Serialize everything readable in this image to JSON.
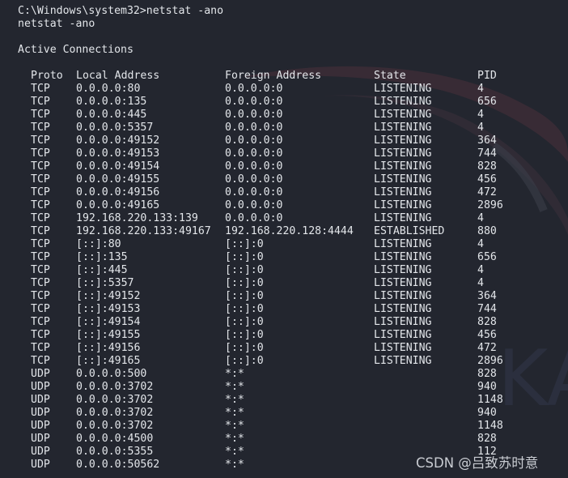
{
  "terminal": {
    "prompt_line": "C:\\Windows\\system32>netstat -ano",
    "echo_line": "netstat -ano",
    "section_title": "Active Connections",
    "headers": {
      "proto": "Proto",
      "local": "Local Address",
      "foreign": "Foreign Address",
      "state": "State",
      "pid": "PID"
    },
    "rows": [
      {
        "proto": "TCP",
        "local": "0.0.0.0:80",
        "foreign": "0.0.0.0:0",
        "state": "LISTENING",
        "pid": "4"
      },
      {
        "proto": "TCP",
        "local": "0.0.0.0:135",
        "foreign": "0.0.0.0:0",
        "state": "LISTENING",
        "pid": "656"
      },
      {
        "proto": "TCP",
        "local": "0.0.0.0:445",
        "foreign": "0.0.0.0:0",
        "state": "LISTENING",
        "pid": "4"
      },
      {
        "proto": "TCP",
        "local": "0.0.0.0:5357",
        "foreign": "0.0.0.0:0",
        "state": "LISTENING",
        "pid": "4"
      },
      {
        "proto": "TCP",
        "local": "0.0.0.0:49152",
        "foreign": "0.0.0.0:0",
        "state": "LISTENING",
        "pid": "364"
      },
      {
        "proto": "TCP",
        "local": "0.0.0.0:49153",
        "foreign": "0.0.0.0:0",
        "state": "LISTENING",
        "pid": "744"
      },
      {
        "proto": "TCP",
        "local": "0.0.0.0:49154",
        "foreign": "0.0.0.0:0",
        "state": "LISTENING",
        "pid": "828"
      },
      {
        "proto": "TCP",
        "local": "0.0.0.0:49155",
        "foreign": "0.0.0.0:0",
        "state": "LISTENING",
        "pid": "456"
      },
      {
        "proto": "TCP",
        "local": "0.0.0.0:49156",
        "foreign": "0.0.0.0:0",
        "state": "LISTENING",
        "pid": "472"
      },
      {
        "proto": "TCP",
        "local": "0.0.0.0:49165",
        "foreign": "0.0.0.0:0",
        "state": "LISTENING",
        "pid": "2896"
      },
      {
        "proto": "TCP",
        "local": "192.168.220.133:139",
        "foreign": "0.0.0.0:0",
        "state": "LISTENING",
        "pid": "4"
      },
      {
        "proto": "TCP",
        "local": "192.168.220.133:49167",
        "foreign": "192.168.220.128:4444",
        "state": "ESTABLISHED",
        "pid": "880"
      },
      {
        "proto": "TCP",
        "local": "[::]:80",
        "foreign": "[::]:0",
        "state": "LISTENING",
        "pid": "4"
      },
      {
        "proto": "TCP",
        "local": "[::]:135",
        "foreign": "[::]:0",
        "state": "LISTENING",
        "pid": "656"
      },
      {
        "proto": "TCP",
        "local": "[::]:445",
        "foreign": "[::]:0",
        "state": "LISTENING",
        "pid": "4"
      },
      {
        "proto": "TCP",
        "local": "[::]:5357",
        "foreign": "[::]:0",
        "state": "LISTENING",
        "pid": "4"
      },
      {
        "proto": "TCP",
        "local": "[::]:49152",
        "foreign": "[::]:0",
        "state": "LISTENING",
        "pid": "364"
      },
      {
        "proto": "TCP",
        "local": "[::]:49153",
        "foreign": "[::]:0",
        "state": "LISTENING",
        "pid": "744"
      },
      {
        "proto": "TCP",
        "local": "[::]:49154",
        "foreign": "[::]:0",
        "state": "LISTENING",
        "pid": "828"
      },
      {
        "proto": "TCP",
        "local": "[::]:49155",
        "foreign": "[::]:0",
        "state": "LISTENING",
        "pid": "456"
      },
      {
        "proto": "TCP",
        "local": "[::]:49156",
        "foreign": "[::]:0",
        "state": "LISTENING",
        "pid": "472"
      },
      {
        "proto": "TCP",
        "local": "[::]:49165",
        "foreign": "[::]:0",
        "state": "LISTENING",
        "pid": "2896"
      },
      {
        "proto": "UDP",
        "local": "0.0.0.0:500",
        "foreign": "*:*",
        "state": "",
        "pid": "828"
      },
      {
        "proto": "UDP",
        "local": "0.0.0.0:3702",
        "foreign": "*:*",
        "state": "",
        "pid": "940"
      },
      {
        "proto": "UDP",
        "local": "0.0.0.0:3702",
        "foreign": "*:*",
        "state": "",
        "pid": "1148"
      },
      {
        "proto": "UDP",
        "local": "0.0.0.0:3702",
        "foreign": "*:*",
        "state": "",
        "pid": "940"
      },
      {
        "proto": "UDP",
        "local": "0.0.0.0:3702",
        "foreign": "*:*",
        "state": "",
        "pid": "1148"
      },
      {
        "proto": "UDP",
        "local": "0.0.0.0:4500",
        "foreign": "*:*",
        "state": "",
        "pid": "828"
      },
      {
        "proto": "UDP",
        "local": "0.0.0.0:5355",
        "foreign": "*:*",
        "state": "",
        "pid": "112"
      },
      {
        "proto": "UDP",
        "local": "0.0.0.0:50562",
        "foreign": "*:*",
        "state": "",
        "pid": ""
      }
    ]
  },
  "watermark": "CSDN @吕致苏时意",
  "colors": {
    "background": "#23262f",
    "text": "#e3e6ea",
    "swoosh": "#5a3540"
  }
}
